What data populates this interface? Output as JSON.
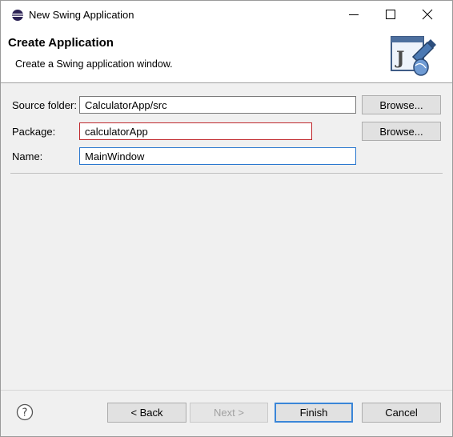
{
  "window": {
    "title": "New Swing Application"
  },
  "header": {
    "title": "Create Application",
    "description": "Create a Swing application window.",
    "icon": "java-swing-wizard-icon"
  },
  "form": {
    "source_folder": {
      "label": "Source folder:",
      "value": "CalculatorApp/src",
      "browse_label": "Browse..."
    },
    "package": {
      "label": "Package:",
      "value": "calculatorApp",
      "browse_label": "Browse..."
    },
    "name": {
      "label": "Name:",
      "value": "MainWindow"
    }
  },
  "footer": {
    "help_icon": "help-question-icon",
    "back_label": "< Back",
    "next_label": "Next >",
    "finish_label": "Finish",
    "cancel_label": "Cancel"
  },
  "colors": {
    "error_border": "#c0282d",
    "focus_border": "#2b78cf",
    "default_button_border": "#3b86d8"
  }
}
